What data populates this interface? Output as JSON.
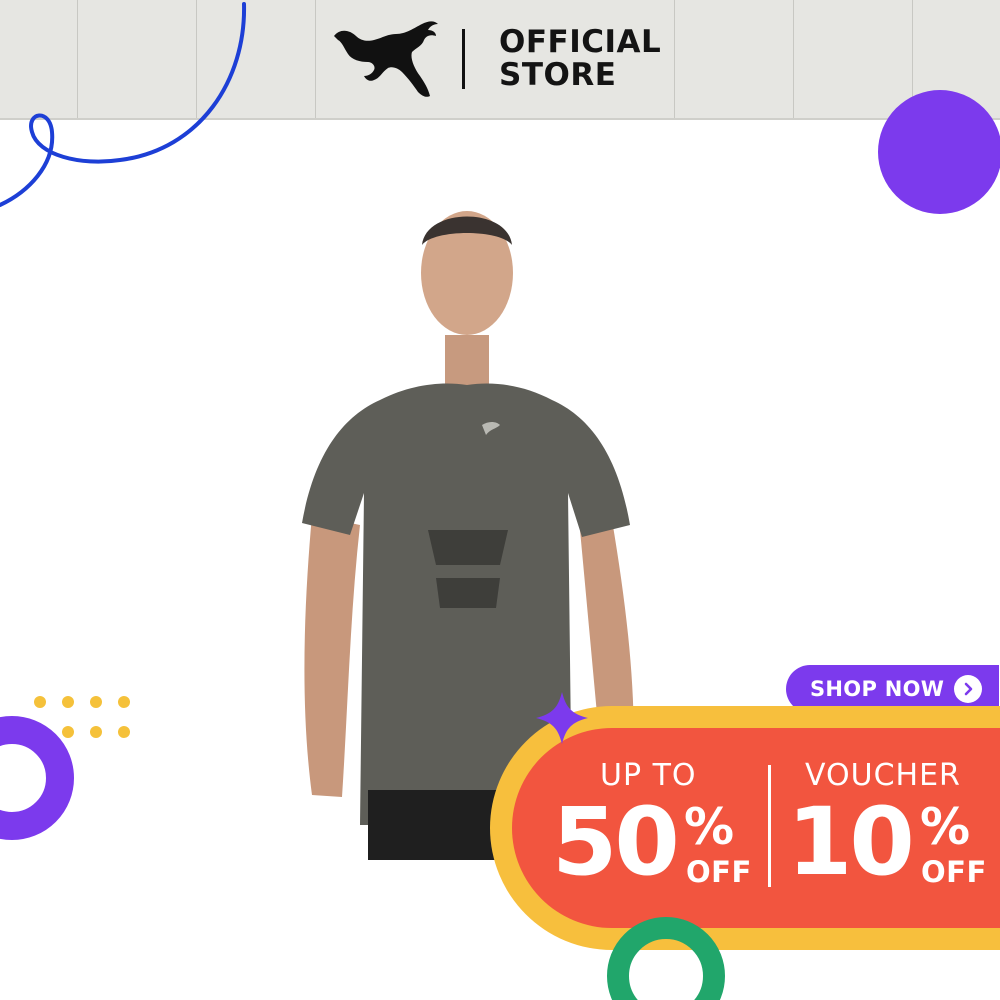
{
  "header": {
    "brand_icon": "puma-cat-logo",
    "title_line1": "OFFICIAL",
    "title_line2": "STORE"
  },
  "product": {
    "image_subject": "man-wearing-grey-puma-tshirt"
  },
  "promo": {
    "cta_label": "SHOP NOW",
    "cta_icon": "chevron-right-icon",
    "left_caption": "UP TO",
    "left_value": "50",
    "left_percent": "%",
    "left_suffix": "OFF",
    "right_caption": "VOUCHER",
    "right_value": "10",
    "right_percent": "%",
    "right_suffix": "OFF"
  },
  "colors": {
    "header_bg": "#e6e6e2",
    "accent_purple": "#7c3aed",
    "banner_red": "#f2553f",
    "banner_yellow": "#f7bf3d",
    "ring_green": "#21a66b",
    "line_blue": "#1d3fd6",
    "dots_yellow": "#f5c13a"
  }
}
